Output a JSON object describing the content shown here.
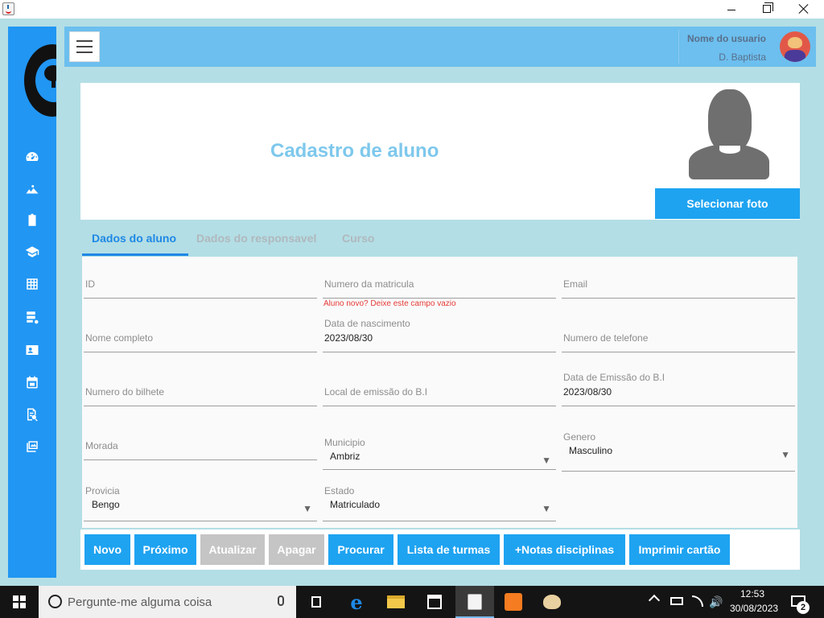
{
  "window": {
    "minimize_glyph": "—",
    "maximize_glyph": "❐",
    "close_glyph": "✕"
  },
  "user": {
    "title": "Nome do usuario",
    "name": "D. Baptista"
  },
  "sidebar": {
    "icons": [
      "dashboard-icon",
      "landscape-icon",
      "id-badge-icon",
      "graduation-cap-icon",
      "calculator-icon",
      "database-icon",
      "contact-card-icon",
      "calendar-icon",
      "document-search-icon",
      "gallery-icon"
    ]
  },
  "header": {
    "title": "Cadastro de aluno",
    "select_photo_label": "Selecionar foto"
  },
  "tabs": [
    {
      "label": "Dados do aluno",
      "active": true
    },
    {
      "label": "Dados do responsavel",
      "active": false
    },
    {
      "label": "Curso",
      "active": false
    }
  ],
  "form": {
    "id": {
      "label": "ID",
      "value": ""
    },
    "matricula": {
      "label": "Numero da matricula",
      "value": "",
      "hint": "Aluno novo? Deixe este campo vazio"
    },
    "email": {
      "label": "Email",
      "value": ""
    },
    "nome": {
      "label": "Nome completo",
      "value": ""
    },
    "nascimento": {
      "label": "Data de nascimento",
      "value": "2023/08/30"
    },
    "telefone": {
      "label": "Numero de telefone",
      "value": ""
    },
    "bilhete": {
      "label": "Numero do bilhete",
      "value": ""
    },
    "local_emissao": {
      "label": "Local de emissão do B.I",
      "value": ""
    },
    "data_emissao": {
      "label": "Data de Emissão do B.I",
      "value": "2023/08/30"
    },
    "morada": {
      "label": "Morada",
      "value": ""
    },
    "municipio": {
      "label": "Municipio",
      "value": "Ambriz"
    },
    "genero": {
      "label": "Genero",
      "value": "Masculino"
    },
    "provincia": {
      "label": "Provicia",
      "value": "Bengo"
    },
    "estado": {
      "label": "Estado",
      "value": "Matriculado"
    },
    "dropdown_arrow": "▼"
  },
  "actions": [
    {
      "label": "Novo",
      "enabled": true
    },
    {
      "label": "Próximo",
      "enabled": true
    },
    {
      "label": "Atualizar",
      "enabled": false
    },
    {
      "label": "Apagar",
      "enabled": false
    },
    {
      "label": "Procurar",
      "enabled": true
    },
    {
      "label": "Lista de turmas",
      "enabled": true
    },
    {
      "label": "+Notas disciplinas",
      "enabled": true
    },
    {
      "label": "Imprimir cartão",
      "enabled": true
    }
  ],
  "taskbar": {
    "search_placeholder": "Pergunte-me alguma coisa",
    "edge_glyph": "e",
    "speaker_glyph": "🔊",
    "time": "12:53",
    "date": "30/08/2023",
    "notification_count": "2"
  },
  "colors": {
    "sidebar": "#2196f3",
    "topbar": "#6cbfee",
    "background": "#b3dee5",
    "primary_button": "#1ea3f1",
    "disabled_button": "#c5c5c5",
    "title": "#7ec8ec",
    "hint": "#e53935"
  }
}
